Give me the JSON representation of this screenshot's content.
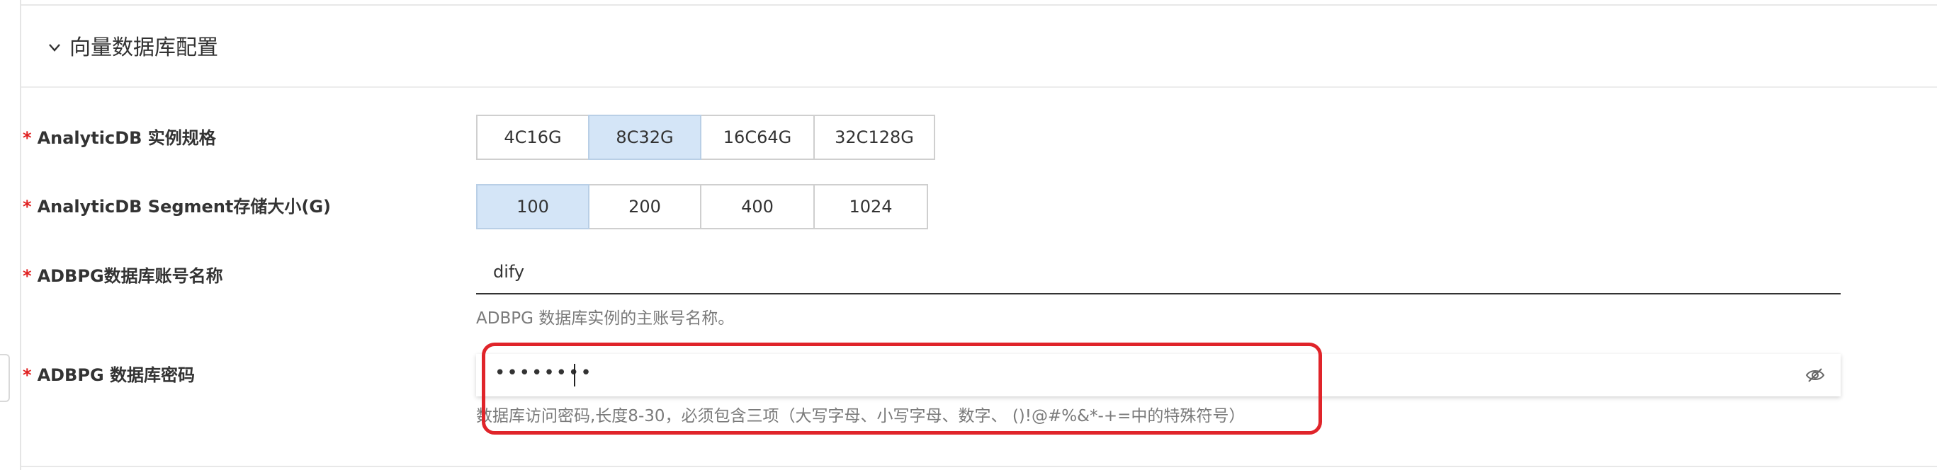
{
  "section": {
    "title": "向量数据库配置",
    "chevron_icon": "chevron-down-icon"
  },
  "form": {
    "required_mark": "*",
    "instance_spec": {
      "label": "AnalyticDB 实例规格",
      "options": [
        "4C16G",
        "8C32G",
        "16C64G",
        "32C128G"
      ],
      "selected": "8C32G"
    },
    "segment_storage": {
      "label": "AnalyticDB Segment存储大小(G)",
      "options": [
        "100",
        "200",
        "400",
        "1024"
      ],
      "selected": "100"
    },
    "account_name": {
      "label": "ADBPG数据库账号名称",
      "value": "dify",
      "help": "ADBPG 数据库实例的主账号名称。"
    },
    "password": {
      "label": "ADBPG 数据库密码",
      "value_masked": "••••••••",
      "toggle_icon": "eye-slash-icon",
      "help": "数据库访问密码,长度8-30，必须包含三项（大写字母、小写字母、数字、 ()!@#%&*-+=中的特殊符号）"
    }
  },
  "colors": {
    "required": "#e02020",
    "selected_bg": "#d4e5f7",
    "highlight": "#e0242a"
  }
}
